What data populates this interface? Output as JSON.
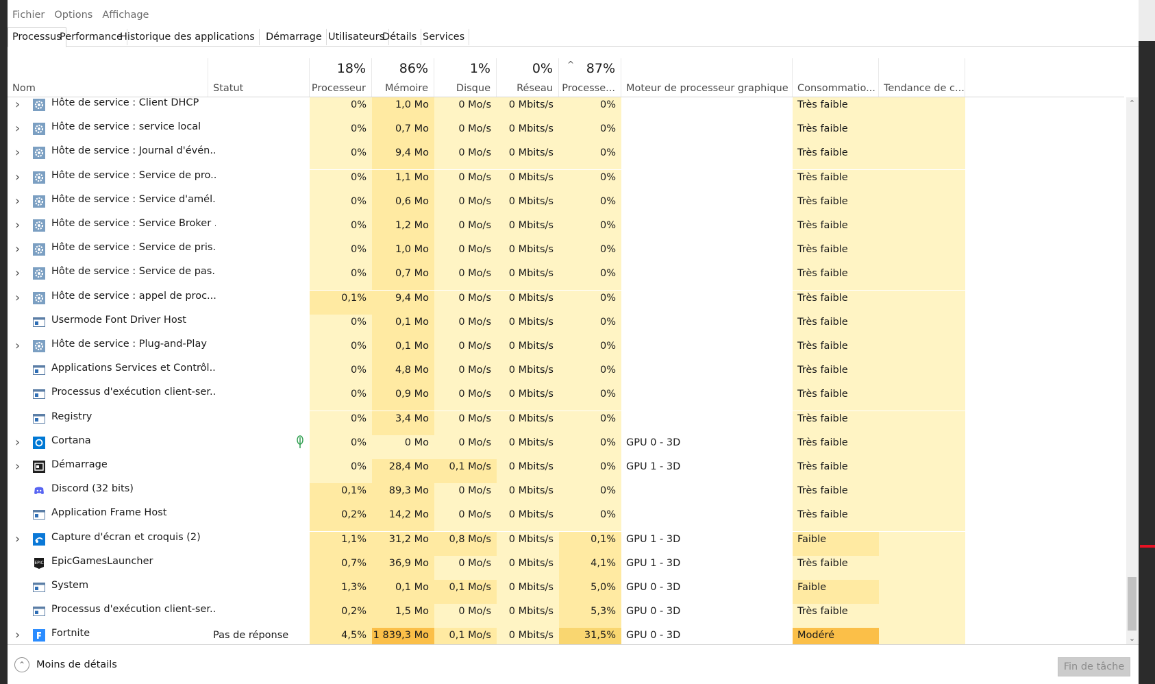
{
  "menu": [
    "Fichier",
    "Options",
    "Affichage"
  ],
  "tabs": [
    "Processus",
    "Performance",
    "Historique des applications",
    "Démarrage",
    "Utilisateurs",
    "Détails",
    "Services"
  ],
  "header": {
    "nom": "Nom",
    "statut": "Statut",
    "cpu_pct": "18%",
    "cpu_label": "Processeur",
    "mem_pct": "86%",
    "mem_label": "Mémoire",
    "disk_pct": "1%",
    "disk_label": "Disque",
    "net_pct": "0%",
    "net_label": "Réseau",
    "gpu_pct": "87%",
    "gpu_label": "Processe...",
    "sort_caret": "^",
    "gpu_engine_label": "Moteur de processeur graphique",
    "power_label": "Consommatio...",
    "trend_label": "Tendance de c..."
  },
  "colors": {
    "heat_low": "#fff4c4",
    "heat_med": "#ffeaa2",
    "heat_high": "#f9d670",
    "heat_max": "#fbbf48",
    "icon_gear": "#7b9fc2",
    "icon_window": "#2f6eb5",
    "icon_cortana": "#0078d4",
    "icon_discord": "#5865f2"
  },
  "rows": [
    {
      "expand": true,
      "icon": "gear-icon",
      "name": "Hôte de service : Client DHCP",
      "status": "",
      "cpu": "0%",
      "mem": "1,0 Mo",
      "disk": "0 Mo/s",
      "net": "0 Mbits/s",
      "gpu": "0%",
      "gpu_engine": "",
      "power": "Très faible",
      "h": [
        "low",
        "med",
        "low",
        "low",
        "low",
        "low"
      ]
    },
    {
      "expand": true,
      "icon": "gear-icon",
      "name": "Hôte de service : service local",
      "status": "",
      "cpu": "0%",
      "mem": "0,7 Mo",
      "disk": "0 Mo/s",
      "net": "0 Mbits/s",
      "gpu": "0%",
      "gpu_engine": "",
      "power": "Très faible",
      "h": [
        "low",
        "med",
        "low",
        "low",
        "low",
        "low"
      ]
    },
    {
      "expand": true,
      "icon": "gear-icon",
      "name": "Hôte de service : Journal d'évén...",
      "status": "",
      "cpu": "0%",
      "mem": "9,4 Mo",
      "disk": "0 Mo/s",
      "net": "0 Mbits/s",
      "gpu": "0%",
      "gpu_engine": "",
      "power": "Très faible",
      "h": [
        "low",
        "med",
        "low",
        "low",
        "low",
        "low"
      ]
    },
    {
      "expand": true,
      "icon": "gear-icon",
      "name": "Hôte de service : Service de pro...",
      "status": "",
      "cpu": "0%",
      "mem": "1,1 Mo",
      "disk": "0 Mo/s",
      "net": "0 Mbits/s",
      "gpu": "0%",
      "gpu_engine": "",
      "power": "Très faible",
      "h": [
        "low",
        "med",
        "low",
        "low",
        "low",
        "low"
      ]
    },
    {
      "expand": true,
      "icon": "gear-icon",
      "name": "Hôte de service : Service d'amél...",
      "status": "",
      "cpu": "0%",
      "mem": "0,6 Mo",
      "disk": "0 Mo/s",
      "net": "0 Mbits/s",
      "gpu": "0%",
      "gpu_engine": "",
      "power": "Très faible",
      "h": [
        "low",
        "med",
        "low",
        "low",
        "low",
        "low"
      ]
    },
    {
      "expand": true,
      "icon": "gear-icon",
      "name": "Hôte de service : Service Broker ...",
      "status": "",
      "cpu": "0%",
      "mem": "1,2 Mo",
      "disk": "0 Mo/s",
      "net": "0 Mbits/s",
      "gpu": "0%",
      "gpu_engine": "",
      "power": "Très faible",
      "h": [
        "low",
        "med",
        "low",
        "low",
        "low",
        "low"
      ]
    },
    {
      "expand": true,
      "icon": "gear-icon",
      "name": "Hôte de service : Service de pris...",
      "status": "",
      "cpu": "0%",
      "mem": "1,0 Mo",
      "disk": "0 Mo/s",
      "net": "0 Mbits/s",
      "gpu": "0%",
      "gpu_engine": "",
      "power": "Très faible",
      "h": [
        "low",
        "med",
        "low",
        "low",
        "low",
        "low"
      ]
    },
    {
      "expand": true,
      "icon": "gear-icon",
      "name": "Hôte de service : Service de pas...",
      "status": "",
      "cpu": "0%",
      "mem": "0,7 Mo",
      "disk": "0 Mo/s",
      "net": "0 Mbits/s",
      "gpu": "0%",
      "gpu_engine": "",
      "power": "Très faible",
      "h": [
        "low",
        "med",
        "low",
        "low",
        "low",
        "low"
      ]
    },
    {
      "expand": true,
      "icon": "gear-icon",
      "name": "Hôte de service : appel de proc...",
      "status": "",
      "cpu": "0,1%",
      "mem": "9,4 Mo",
      "disk": "0 Mo/s",
      "net": "0 Mbits/s",
      "gpu": "0%",
      "gpu_engine": "",
      "power": "Très faible",
      "h": [
        "med",
        "med",
        "low",
        "low",
        "low",
        "low"
      ]
    },
    {
      "expand": false,
      "icon": "window-icon",
      "name": "Usermode Font Driver Host",
      "status": "",
      "cpu": "0%",
      "mem": "0,1 Mo",
      "disk": "0 Mo/s",
      "net": "0 Mbits/s",
      "gpu": "0%",
      "gpu_engine": "",
      "power": "Très faible",
      "h": [
        "low",
        "med",
        "low",
        "low",
        "low",
        "low"
      ]
    },
    {
      "expand": true,
      "icon": "gear-icon",
      "name": "Hôte de service : Plug-and-Play",
      "status": "",
      "cpu": "0%",
      "mem": "0,1 Mo",
      "disk": "0 Mo/s",
      "net": "0 Mbits/s",
      "gpu": "0%",
      "gpu_engine": "",
      "power": "Très faible",
      "h": [
        "low",
        "med",
        "low",
        "low",
        "low",
        "low"
      ]
    },
    {
      "expand": false,
      "icon": "window-icon",
      "name": "Applications Services et Contrôl...",
      "status": "",
      "cpu": "0%",
      "mem": "4,8 Mo",
      "disk": "0 Mo/s",
      "net": "0 Mbits/s",
      "gpu": "0%",
      "gpu_engine": "",
      "power": "Très faible",
      "h": [
        "low",
        "med",
        "low",
        "low",
        "low",
        "low"
      ]
    },
    {
      "expand": false,
      "icon": "window-icon",
      "name": "Processus d'exécution client-ser...",
      "status": "",
      "cpu": "0%",
      "mem": "0,9 Mo",
      "disk": "0 Mo/s",
      "net": "0 Mbits/s",
      "gpu": "0%",
      "gpu_engine": "",
      "power": "Très faible",
      "h": [
        "low",
        "med",
        "low",
        "low",
        "low",
        "low"
      ]
    },
    {
      "expand": false,
      "icon": "window-icon",
      "name": "Registry",
      "status": "",
      "cpu": "0%",
      "mem": "3,4 Mo",
      "disk": "0 Mo/s",
      "net": "0 Mbits/s",
      "gpu": "0%",
      "gpu_engine": "",
      "power": "Très faible",
      "h": [
        "low",
        "med",
        "low",
        "low",
        "low",
        "low"
      ]
    },
    {
      "expand": true,
      "icon": "cortana-icon",
      "name": "Cortana",
      "status": "",
      "leaf": true,
      "cpu": "0%",
      "mem": "0 Mo",
      "disk": "0 Mo/s",
      "net": "0 Mbits/s",
      "gpu": "0%",
      "gpu_engine": "GPU 0 - 3D",
      "power": "Très faible",
      "h": [
        "low",
        "low",
        "low",
        "low",
        "low",
        "low"
      ]
    },
    {
      "expand": true,
      "icon": "startup-icon",
      "name": "Démarrage",
      "status": "",
      "cpu": "0%",
      "mem": "28,4 Mo",
      "disk": "0,1 Mo/s",
      "net": "0 Mbits/s",
      "gpu": "0%",
      "gpu_engine": "GPU 1 - 3D",
      "power": "Très faible",
      "h": [
        "low",
        "med",
        "med",
        "low",
        "low",
        "low"
      ]
    },
    {
      "expand": false,
      "icon": "discord-icon",
      "name": "Discord (32 bits)",
      "status": "",
      "cpu": "0,1%",
      "mem": "89,3 Mo",
      "disk": "0 Mo/s",
      "net": "0 Mbits/s",
      "gpu": "0%",
      "gpu_engine": "",
      "power": "Très faible",
      "h": [
        "med",
        "med",
        "low",
        "low",
        "low",
        "low"
      ]
    },
    {
      "expand": false,
      "icon": "window-icon",
      "name": "Application Frame Host",
      "status": "",
      "cpu": "0,2%",
      "mem": "14,2 Mo",
      "disk": "0 Mo/s",
      "net": "0 Mbits/s",
      "gpu": "0%",
      "gpu_engine": "",
      "power": "Très faible",
      "h": [
        "med",
        "med",
        "low",
        "low",
        "low",
        "low"
      ]
    },
    {
      "expand": true,
      "icon": "snip-icon",
      "name": "Capture d'écran et croquis (2)",
      "status": "",
      "cpu": "1,1%",
      "mem": "31,2 Mo",
      "disk": "0,8 Mo/s",
      "net": "0 Mbits/s",
      "gpu": "0,1%",
      "gpu_engine": "GPU 1 - 3D",
      "power": "Faible",
      "h": [
        "med",
        "med",
        "med",
        "low",
        "med",
        "med"
      ]
    },
    {
      "expand": false,
      "icon": "epic-icon",
      "name": "EpicGamesLauncher",
      "status": "",
      "cpu": "0,7%",
      "mem": "36,9 Mo",
      "disk": "0 Mo/s",
      "net": "0 Mbits/s",
      "gpu": "4,1%",
      "gpu_engine": "GPU 1 - 3D",
      "power": "Très faible",
      "h": [
        "med",
        "med",
        "low",
        "low",
        "med",
        "low"
      ]
    },
    {
      "expand": false,
      "icon": "window-icon",
      "name": "System",
      "status": "",
      "cpu": "1,3%",
      "mem": "0,1 Mo",
      "disk": "0,1 Mo/s",
      "net": "0 Mbits/s",
      "gpu": "5,0%",
      "gpu_engine": "GPU 0 - 3D",
      "power": "Faible",
      "h": [
        "med",
        "med",
        "med",
        "low",
        "med",
        "med"
      ]
    },
    {
      "expand": false,
      "icon": "window-icon",
      "name": "Processus d'exécution client-ser...",
      "status": "",
      "cpu": "0,2%",
      "mem": "1,5 Mo",
      "disk": "0 Mo/s",
      "net": "0 Mbits/s",
      "gpu": "5,3%",
      "gpu_engine": "GPU 0 - 3D",
      "power": "Très faible",
      "h": [
        "med",
        "med",
        "low",
        "low",
        "med",
        "low"
      ]
    },
    {
      "expand": true,
      "icon": "fortnite-icon",
      "name": "Fortnite",
      "status": "Pas de réponse",
      "cpu": "4,5%",
      "mem": "1 839,3 Mo",
      "disk": "0,1 Mo/s",
      "net": "0 Mbits/s",
      "gpu": "31,5%",
      "gpu_engine": "GPU 0 - 3D",
      "power": "Modéré",
      "h": [
        "med",
        "max",
        "med",
        "low",
        "high",
        "max"
      ]
    }
  ],
  "footer": {
    "less_details": "Moins de détails",
    "end_task": "Fin de tâche"
  }
}
